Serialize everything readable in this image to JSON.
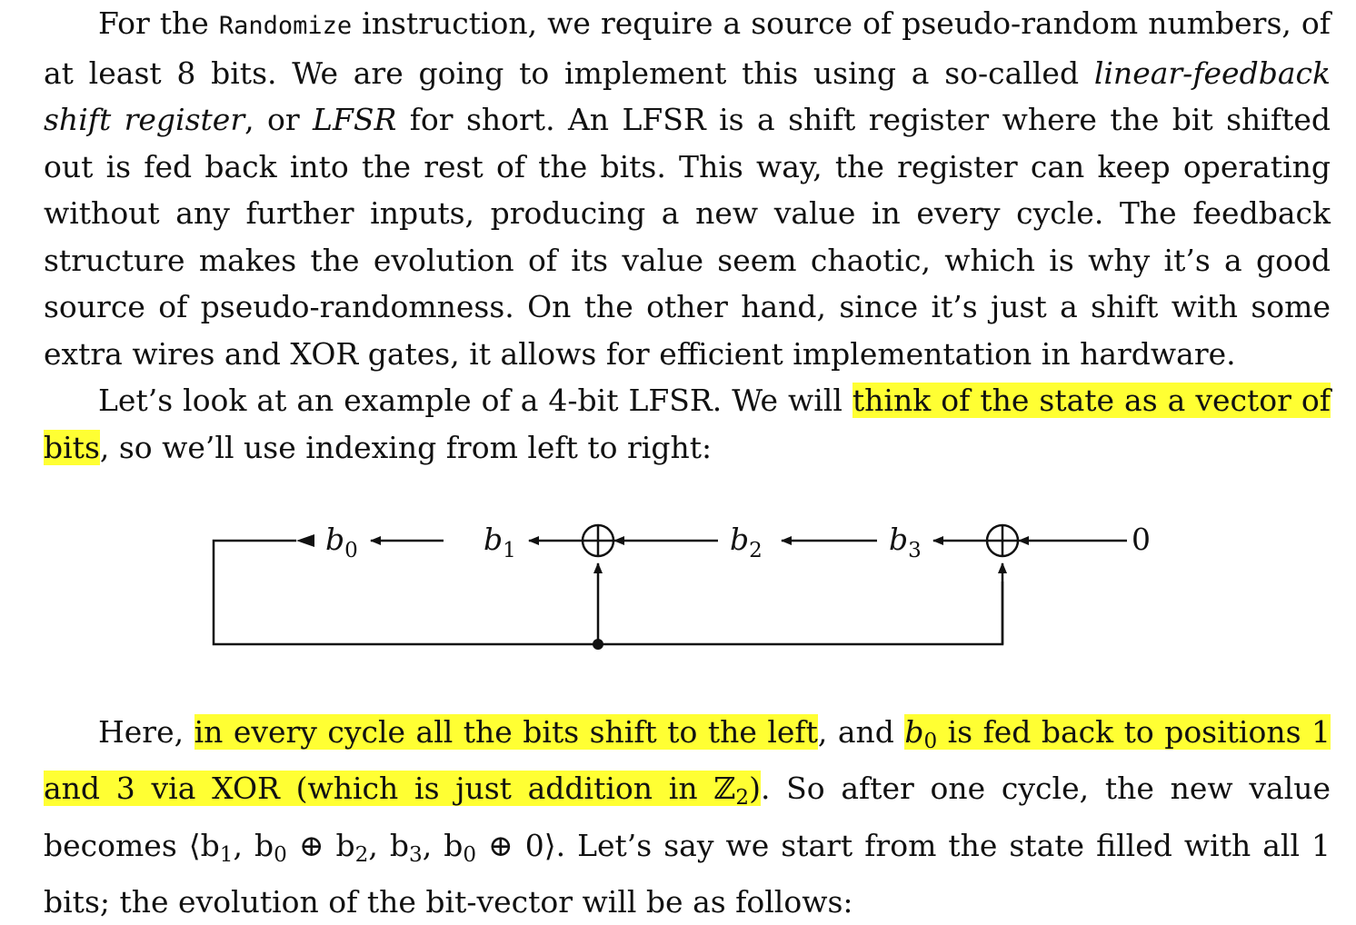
{
  "paragraph1": {
    "t1": "For the ",
    "code": "Randomize",
    "t2": " instruction, we require a source of pseudo-random numbers, of at least 8 bits. We are going to implement this using a so-called ",
    "em1": "linear-feedback shift register",
    "t3": ", or ",
    "em2": "LFSR",
    "t4": " for short. An LFSR is a shift register where the bit shifted out is fed back into the rest of the bits. This way, the register can keep operating without any further inputs, producing a new value in every cycle. The feedback structure makes the evolution of its value seem chaotic, which is why it’s a good source of pseudo-randomness. On the other hand, since it’s just a shift with some extra wires and XOR gates, it allows for efficient implementation in hardware."
  },
  "paragraph2": {
    "t1": "Let’s look at an example of a 4-bit LFSR. We will ",
    "hl1": "think of the state as a vector of bits",
    "t2": ", so we’ll use indexing from left to right:"
  },
  "diagram": {
    "b0": "b",
    "b0_sub": "0",
    "b1": "b",
    "b1_sub": "1",
    "b2": "b",
    "b2_sub": "2",
    "b3": "b",
    "b3_sub": "3",
    "input": "0"
  },
  "paragraph3": {
    "t1": "Here, ",
    "hl1": "in every cycle all the bits shift to the left",
    "t2": ", and ",
    "hl2a": "b",
    "hl2a_sub": "0",
    "hl2b": " is fed back to positions 1 and 3 via XOR (which is just addition in ℤ",
    "hl2b_sub": "2",
    "hl2c": ")",
    "t3": ". So after one cycle, the new value becomes ⟨b",
    "s1": "1",
    "t4": ", b",
    "s2": "0",
    "t5": " ⊕ b",
    "s3": "2",
    "t6": ", b",
    "s4": "3",
    "t7": ", b",
    "s5": "0",
    "t8": " ⊕ 0⟩. Let’s say we start from the state filled with all 1 bits; the evolution of the bit-vector will be as follows:"
  }
}
